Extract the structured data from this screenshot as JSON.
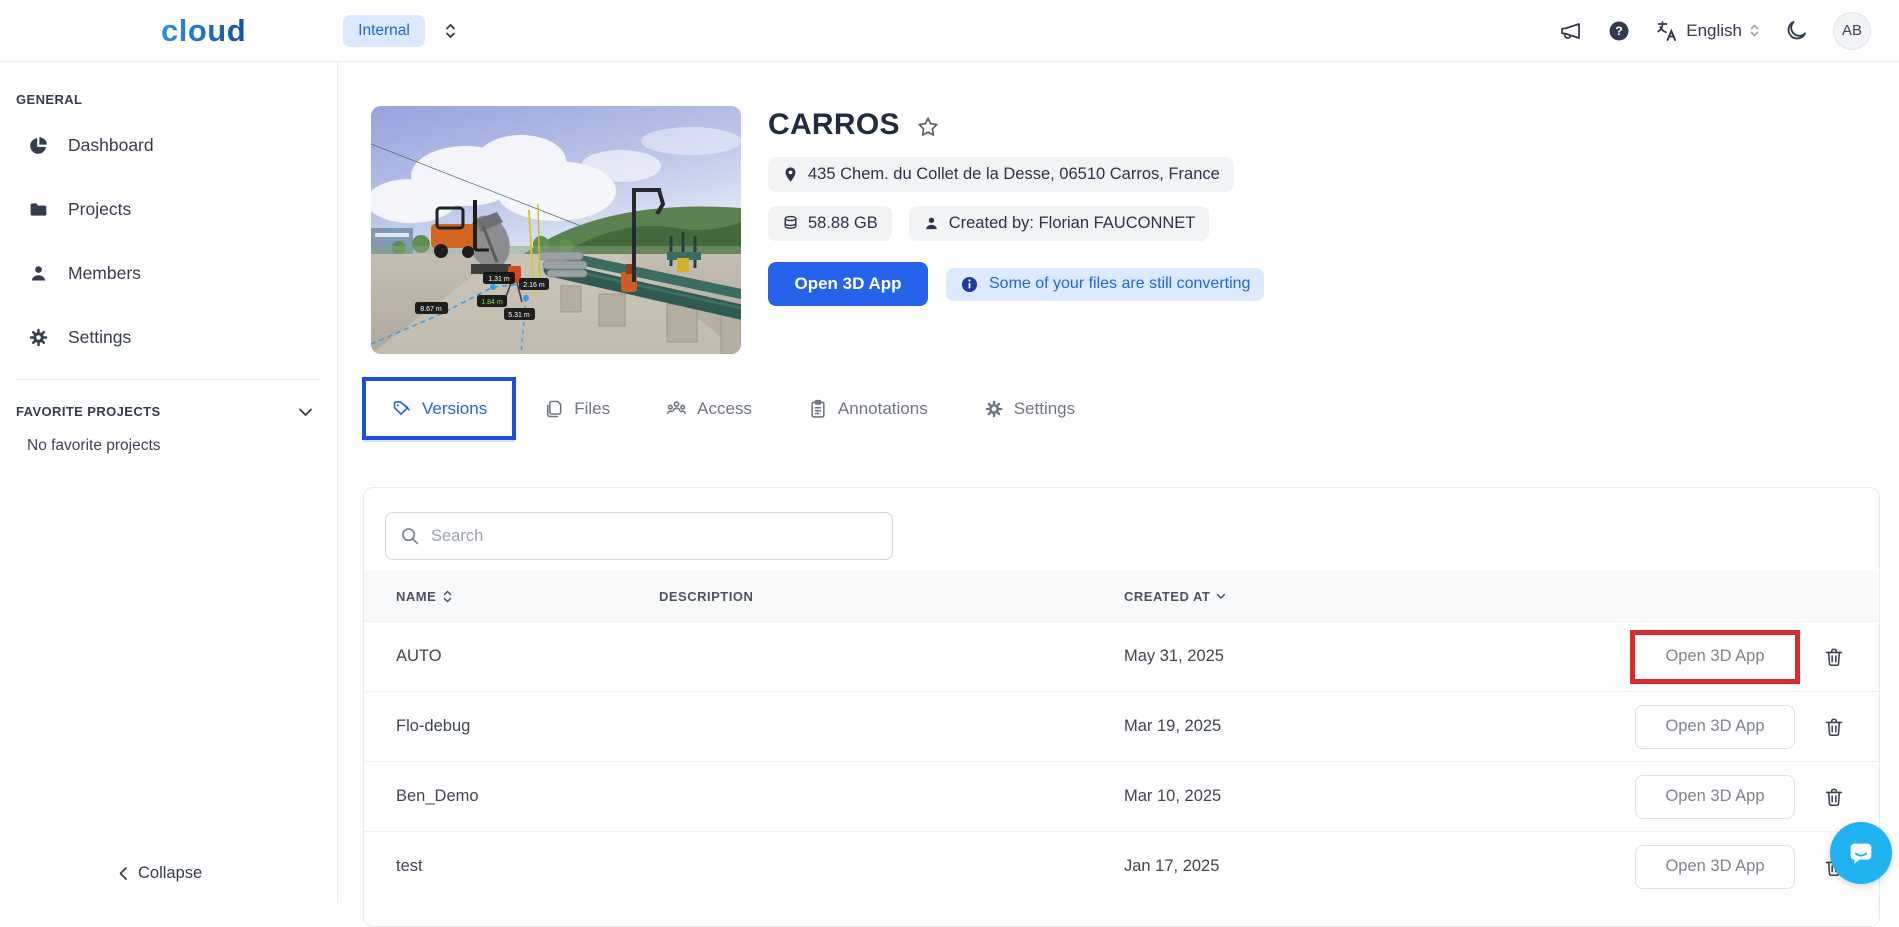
{
  "topbar": {
    "logo": "cloud",
    "workspace": "Internal",
    "language": "English",
    "avatar_initials": "AB"
  },
  "sidebar": {
    "section_general": "GENERAL",
    "items": [
      {
        "label": "Dashboard",
        "icon": "pie-chart-icon"
      },
      {
        "label": "Projects",
        "icon": "folder-icon"
      },
      {
        "label": "Members",
        "icon": "person-icon"
      },
      {
        "label": "Settings",
        "icon": "gear-icon"
      }
    ],
    "section_favorites": "FAVORITE PROJECTS",
    "favorites_empty": "No favorite projects",
    "collapse_label": "Collapse"
  },
  "project": {
    "title": "CARROS",
    "address": "435 Chem. du Collet de la Desse, 06510 Carros, France",
    "size": "58.88 GB",
    "created_by": "Created by: Florian FAUCONNET",
    "open_app_label": "Open 3D App",
    "converting_notice": "Some of your files are still converting"
  },
  "tabs": [
    {
      "label": "Versions",
      "icon": "tags-icon",
      "active": true
    },
    {
      "label": "Files",
      "icon": "files-icon",
      "active": false
    },
    {
      "label": "Access",
      "icon": "people-icon",
      "active": false
    },
    {
      "label": "Annotations",
      "icon": "clipboard-icon",
      "active": false
    },
    {
      "label": "Settings",
      "icon": "gear-icon",
      "active": false
    }
  ],
  "versions_table": {
    "search_placeholder": "Search",
    "columns": {
      "name": "NAME",
      "description": "DESCRIPTION",
      "created_at": "CREATED AT"
    },
    "rows": [
      {
        "name": "AUTO",
        "description": "",
        "created_at": "May 31, 2025",
        "action": "Open 3D App",
        "highlighted": true
      },
      {
        "name": "Flo-debug",
        "description": "",
        "created_at": "Mar 19, 2025",
        "action": "Open 3D App",
        "highlighted": false
      },
      {
        "name": "Ben_Demo",
        "description": "",
        "created_at": "Mar 10, 2025",
        "action": "Open 3D App",
        "highlighted": false
      },
      {
        "name": "test",
        "description": "",
        "created_at": "Jan 17, 2025",
        "action": "Open 3D App",
        "highlighted": false
      }
    ]
  },
  "thumbnail": {
    "description": "3D scan preview of industrial pipeline site with forklift, mixer truck and measurement annotations",
    "measurements": [
      "1.31 m",
      "2.16 m",
      "1.84 m",
      "8.67 m",
      "5.31 m"
    ]
  },
  "colors": {
    "accent": "#2563eb",
    "accent_light": "#dbeafe",
    "tab_outline": "#1d4ed8",
    "highlight_red": "#d92b2b",
    "chat_bubble": "#1fb3f2",
    "notice_icon": "#1d3f99",
    "text_dark": "#343c4e"
  }
}
